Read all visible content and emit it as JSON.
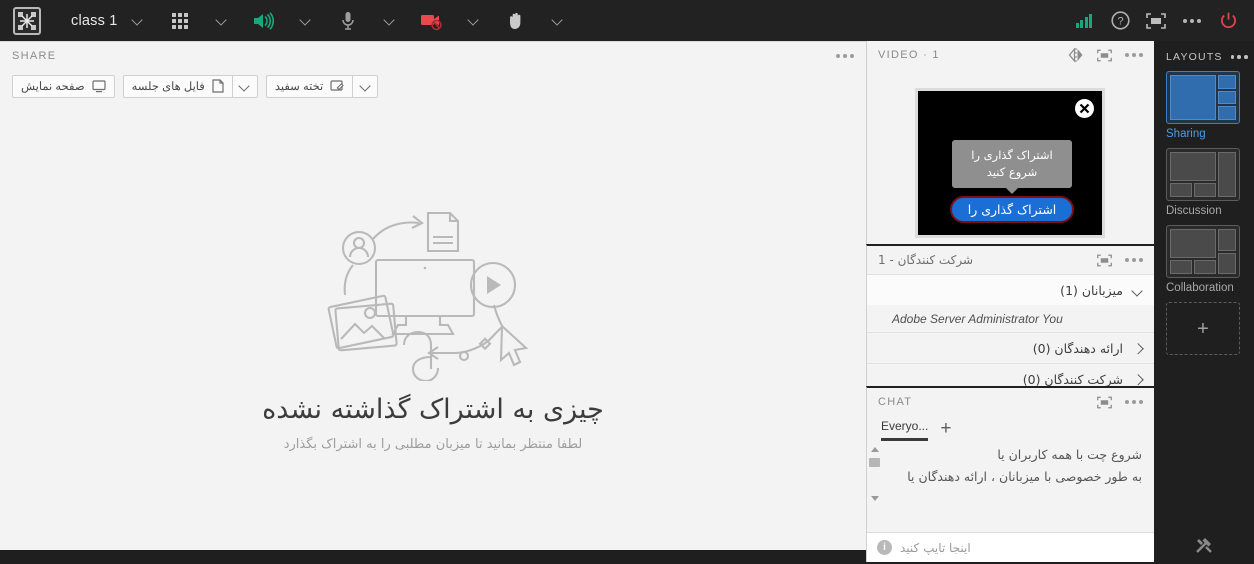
{
  "topbar": {
    "logo_icon": "adobe-connect-logo-icon",
    "meeting_name": "class 1",
    "meeting_caret_icon": "chevron-down-icon",
    "pods_grid_icon": "apps-grid-icon",
    "pods_caret_icon": "chevron-down-icon",
    "speaker_icon": "speaker-on-icon",
    "speaker_caret_icon": "chevron-down-icon",
    "mic_icon": "microphone-icon",
    "mic_caret_icon": "chevron-down-icon",
    "camera_icon": "camera-disabled-icon",
    "camera_caret_icon": "chevron-down-icon",
    "hand_icon": "raise-hand-icon",
    "hand_caret_icon": "chevron-down-icon",
    "signal_icon": "connection-strength-icon",
    "help_icon": "help-question-icon",
    "fullscreen_icon": "fullscreen-icon",
    "more_icon": "more-options-icon",
    "power_icon": "power-end-session-icon"
  },
  "share": {
    "title": "SHARE",
    "more_icon": "more-options-icon",
    "buttons": [
      {
        "label": "صفحه نمایش",
        "icon": "screen-share-icon",
        "has_caret": false
      },
      {
        "label": "فایل های جلسه",
        "icon": "document-icon",
        "has_caret": true,
        "caret_icon": "chevron-down-icon"
      },
      {
        "label": "تخته سفید",
        "icon": "whiteboard-icon",
        "has_caret": true,
        "caret_icon": "chevron-down-icon"
      }
    ],
    "empty_illustration": "share-placeholder-illustration",
    "heading": "چیزی به اشتراک گذاشته نشده",
    "subheading": "لطفا منتظر بمانید تا میزبان مطلبی را به اشتراک بگذارد"
  },
  "video": {
    "title": "VIDEO",
    "separator": "·",
    "count": "1",
    "mirror_icon": "mirror-flip-icon",
    "fullscreen_icon": "fullscreen-icon",
    "more_icon": "more-options-icon",
    "close_icon": "close-icon",
    "tooltip_text": "اشتراک گذاری را شروع کنید",
    "start_button_label": "اشتراک گذاری را",
    "button_fill_color": "#1b6fd4",
    "button_border_color": "#7b1118"
  },
  "attendees": {
    "title": "شرکت کنندگان - 1",
    "fullscreen_icon": "fullscreen-icon",
    "more_icon": "more-options-icon",
    "groups": [
      {
        "label": "میزبانان (1)",
        "expanded": true,
        "toggle_icon": "chevron-down-icon",
        "members": [
          {
            "name": "Adobe Server Administrator You"
          }
        ]
      },
      {
        "label": "ارائه دهندگان (0)",
        "expanded": false,
        "toggle_icon": "chevron-right-icon",
        "members": []
      },
      {
        "label": "شرکت کنندگان (0)",
        "expanded": false,
        "toggle_icon": "chevron-right-icon",
        "members": []
      }
    ]
  },
  "chat": {
    "title": "CHAT",
    "fullscreen_icon": "fullscreen-icon",
    "more_icon": "more-options-icon",
    "tab_label": "Everyo...",
    "add_tab_icon": "plus-icon",
    "message_line1": "شروع چت با همه کاربران یا",
    "message_line2": "به طور خصوصی با میزبانان ، ارائه دهندگان یا",
    "scroll_up_icon": "scroll-up-arrow-icon",
    "scroll_down_icon": "scroll-down-arrow-icon",
    "input_placeholder": "اینجا تایپ کنید",
    "info_icon": "info-icon"
  },
  "layouts": {
    "title": "LAYOUTS",
    "more_icon": "more-options-icon",
    "items": [
      {
        "label": "Sharing",
        "selected": true
      },
      {
        "label": "Discussion",
        "selected": false
      },
      {
        "label": "Collaboration",
        "selected": false
      }
    ],
    "add_label": "+",
    "add_icon": "plus-icon",
    "tools_icon": "tools-hammer-icon",
    "accent_color": "#4a9beb"
  }
}
